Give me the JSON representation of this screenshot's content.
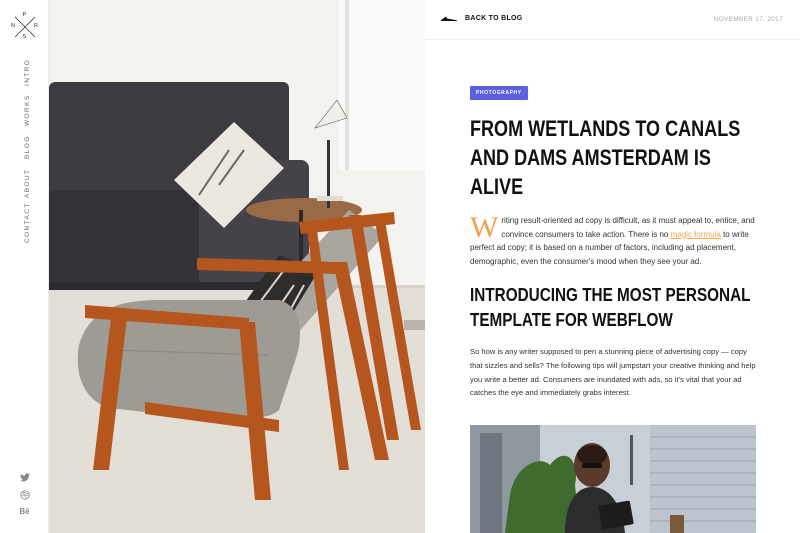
{
  "sidebar": {
    "logo_letters": {
      "top": "P",
      "left": "N",
      "right": "R",
      "bottom": "S"
    },
    "nav": [
      {
        "label": "INTRO"
      },
      {
        "label": "WORKS"
      },
      {
        "label": "BLOG"
      },
      {
        "label": "ABOUT"
      },
      {
        "label": "CONTACT"
      }
    ],
    "social": {
      "behance_label": "Bē"
    }
  },
  "header": {
    "back_label": "BACK TO BLOG",
    "date": "NOVEMBER 17, 2017"
  },
  "article": {
    "category": "PHOTOGRAPHY",
    "title": "FROM WETLANDS TO CANALS AND DAMS AMSTERDAM IS ALIVE",
    "intro": {
      "dropcap": "W",
      "text_before_link": "riting result-oriented ad copy is difficult, as it must appeal to, entice, and convince consumers to take action. There is no ",
      "link_text": "magic formula",
      "text_after_link": " to write perfect ad copy; it is based on a number of factors, including ad placement, demographic, even the consumer's mood when they see your ad."
    },
    "subtitle": "INTRODUCING THE MOST PERSONAL TEMPLATE FOR WEBFLOW",
    "body": "So how is any writer supposed to pen a stunning piece of advertising copy — copy that sizzles and sells? The following tips will jumpstart your creative thinking and help you write a better ad. Consumers are inundated with ads, so it's vital that your ad catches the eye and immediately grabs interest."
  },
  "colors": {
    "accent": "#f0a24a",
    "badge": "#5b5fe0"
  },
  "icons": [
    "twitter-icon",
    "dribbble-icon",
    "behance-icon",
    "back-arrow-icon"
  ]
}
